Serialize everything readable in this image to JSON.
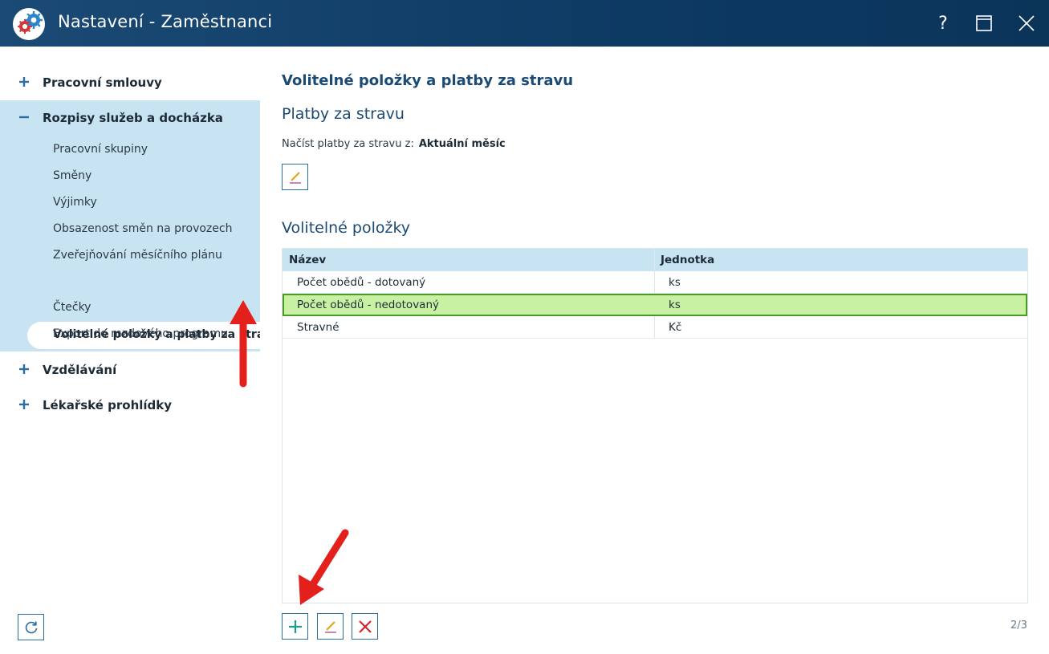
{
  "window": {
    "title": "Nastavení - Zaměstnanci",
    "help_label": "?",
    "icons": {
      "logo": "gears-icon",
      "maximize": "maximize-icon",
      "close": "close-icon"
    }
  },
  "sidebar": {
    "groups": [
      {
        "label": "Pracovní smlouvy",
        "state": "collapsed",
        "sign": "+"
      },
      {
        "label": "Rozpisy služeb a docházka",
        "state": "expanded",
        "sign": "−"
      },
      {
        "label": "Vzdělávání",
        "state": "collapsed",
        "sign": "+"
      },
      {
        "label": "Lékařské prohlídky",
        "state": "collapsed",
        "sign": "+"
      }
    ],
    "sub_items": [
      "Pracovní skupiny",
      "Směny",
      "Výjimky",
      "Obsazenost směn na provozech",
      "Zveřejňování měsíčního plánu",
      "Volitelné položky a platby za stravu",
      "Čtečky",
      "Export do mzdového programu"
    ],
    "active_sub_item": "Volitelné položky a platby za stravu",
    "refresh_icon": "refresh-icon"
  },
  "main": {
    "title": "Volitelné položky a platby za stravu",
    "meal_section": {
      "heading": "Platby za stravu",
      "load_label": "Načíst platby za stravu z:",
      "load_value": "Aktuální měsíc"
    },
    "optional_section": {
      "heading": "Volitelné položky",
      "columns": [
        "Název",
        "Jednotka"
      ],
      "rows": [
        {
          "name": "Počet obědů - dotovaný",
          "unit": "ks",
          "selected": false
        },
        {
          "name": "Počet obědů - nedotovaný",
          "unit": "ks",
          "selected": true
        },
        {
          "name": "Stravné",
          "unit": "Kč",
          "selected": false
        }
      ]
    },
    "pager": "2/3"
  },
  "colors": {
    "titlebar": "#0d3a63",
    "sidebar_highlight": "#c8e3f2",
    "heading": "#1b4a73",
    "selected_row": "#c9f1a3",
    "selected_border": "#4c9a2a",
    "add_icon": "#1a9b8b",
    "delete_icon": "#d0262e",
    "annotation_arrow": "#e3201b"
  }
}
